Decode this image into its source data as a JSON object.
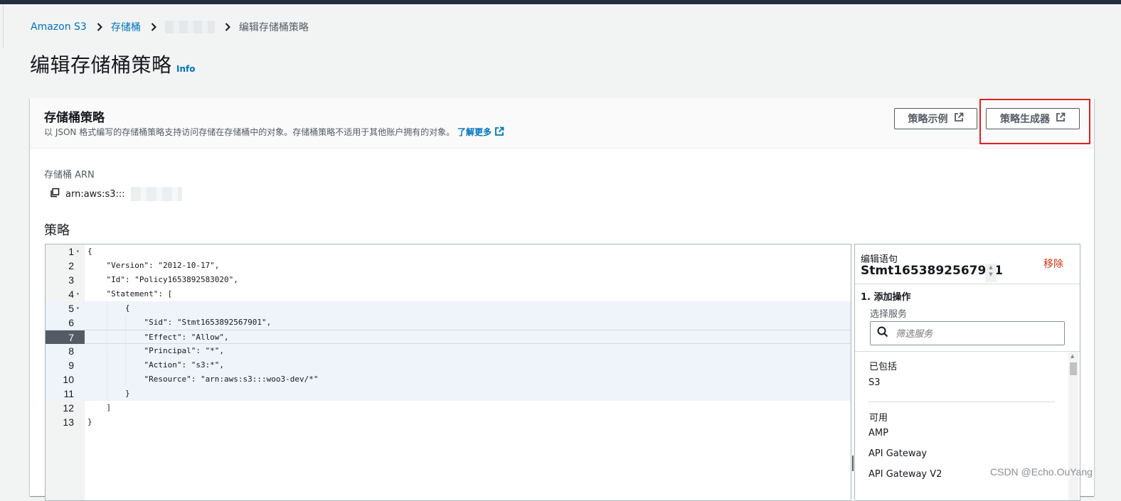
{
  "breadcrumb": {
    "root": "Amazon S3",
    "buckets": "存储桶",
    "current": "编辑存储桶策略"
  },
  "page": {
    "title": "编辑存储桶策略",
    "info": "Info"
  },
  "panel": {
    "title": "存储桶策略",
    "description": "以 JSON 格式编写的存储桶策略支持访问存储在存储桶中的对象。存储桶策略不适用于其他账户拥有的对象。",
    "learn_more": "了解更多",
    "btn_examples": "策略示例",
    "btn_generator": "策略生成器"
  },
  "arn": {
    "label": "存储桶 ARN",
    "value": "arn:aws:s3:::"
  },
  "policy": {
    "label": "策略",
    "lines": [
      {
        "n": "1",
        "text": "{"
      },
      {
        "n": "2",
        "text": "    \"Version\": \"2012-10-17\","
      },
      {
        "n": "3",
        "text": "    \"Id\": \"Policy1653892583020\","
      },
      {
        "n": "4",
        "text": "    \"Statement\": ["
      },
      {
        "n": "5",
        "text": "        {"
      },
      {
        "n": "6",
        "text": "            \"Sid\": \"Stmt1653892567901\","
      },
      {
        "n": "7",
        "text": "            \"Effect\": \"Allow\","
      },
      {
        "n": "8",
        "text": "            \"Principal\": \"*\","
      },
      {
        "n": "9",
        "text": "            \"Action\": \"s3:*\","
      },
      {
        "n": "10",
        "text": "            \"Resource\": \"arn:aws:s3:::woo3-dev/*\""
      },
      {
        "n": "11",
        "text": "        }"
      },
      {
        "n": "12",
        "text": "    ]"
      },
      {
        "n": "13",
        "text": "}"
      }
    ]
  },
  "statement_editor": {
    "label": "编辑语句",
    "statement_id": "Stmt1653892567901",
    "remove": "移除",
    "step": "1. 添加操作",
    "choose_service": "选择服务",
    "search_placeholder": "筛选服务",
    "included_header": "已包括",
    "included": [
      "S3"
    ],
    "available_header": "可用",
    "available": [
      "AMP",
      "API Gateway",
      "API Gateway V2"
    ]
  },
  "watermark": "CSDN @Echo.OuYang",
  "colors": {
    "link": "#0073bb",
    "danger": "#d13212",
    "highlight": "#e02020",
    "topbar": "#232f3e"
  }
}
